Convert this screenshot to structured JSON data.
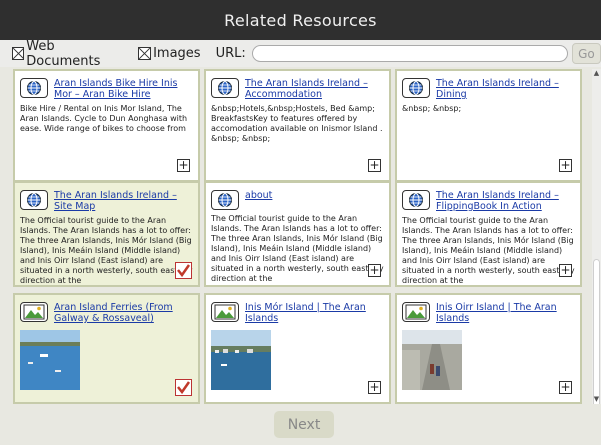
{
  "window": {
    "title": "Related Resources"
  },
  "toolbar": {
    "web_documents_label": "Web Documents",
    "images_label": "Images",
    "url_label": "URL:",
    "url_value": "",
    "go_label": "Go"
  },
  "cards": [
    {
      "type": "web",
      "title": "Aran Islands Bike Hire Inis Mor – Aran Bike Hire",
      "description": "Bike Hire / Rental on Inis Mor Island, The Aran Islands. Cycle to Dun Aonghasa with ease. Wide range of bikes to choose from",
      "selected": false
    },
    {
      "type": "web",
      "title": "The Aran Islands Ireland – Accommodation",
      "description": "&nbsp;Hotels,&nbsp;Hostels, Bed &amp; BreakfastsKey to features offered by accomodation available on Inismor Island . &nbsp; &nbsp;",
      "selected": false
    },
    {
      "type": "web",
      "title": "The Aran Islands Ireland – Dining",
      "description": "&nbsp; &nbsp;",
      "selected": false
    },
    {
      "type": "web",
      "title": "The Aran Islands Ireland – Site Map",
      "description": "The Official tourist guide to the Aran Islands. The Aran Islands has a lot to offer: The three Aran Islands, Inis Mór Island (Big Island), Inis Meáin Island (Middle island) and Inis Oirr Island (East island) are situated in a north westerly, south easterly direction at the",
      "selected": true
    },
    {
      "type": "web",
      "title": "about",
      "description": "The Official tourist guide to the Aran Islands. The Aran Islands has a lot to offer: The three Aran Islands, Inis Mór Island (Big Island), Inis Meáin Island (Middle island) and Inis Oirr Island (East island) are situated in a north westerly, south easterly direction at the",
      "selected": false
    },
    {
      "type": "web",
      "title": "The Aran Islands Ireland – FlippingBook In Action",
      "description": "The Official tourist guide to the Aran Islands. The Aran Islands has a lot to offer: The three Aran Islands, Inis Mór Island (Big Island), Inis Meáin Island (Middle island) and Inis Oirr Island (East island) are situated in a north westerly, south easterly direction at the",
      "selected": false
    },
    {
      "type": "image",
      "title": "Aran Island Ferries (From Galway & Rossaveal)",
      "thumb": "harbour-sea",
      "selected": true
    },
    {
      "type": "image",
      "title": "Inis Mór Island | The Aran Islands",
      "thumb": "harbour-town",
      "selected": false
    },
    {
      "type": "image",
      "title": "Inis Oirr Island | The Aran Islands",
      "thumb": "walkers-road",
      "selected": false
    }
  ],
  "footer": {
    "next_label": "Next"
  },
  "colors": {
    "titlebar": "#2f2f2f",
    "link": "#1a3aa6",
    "selected_card": "#eef1d8",
    "check": "#c0392b"
  }
}
